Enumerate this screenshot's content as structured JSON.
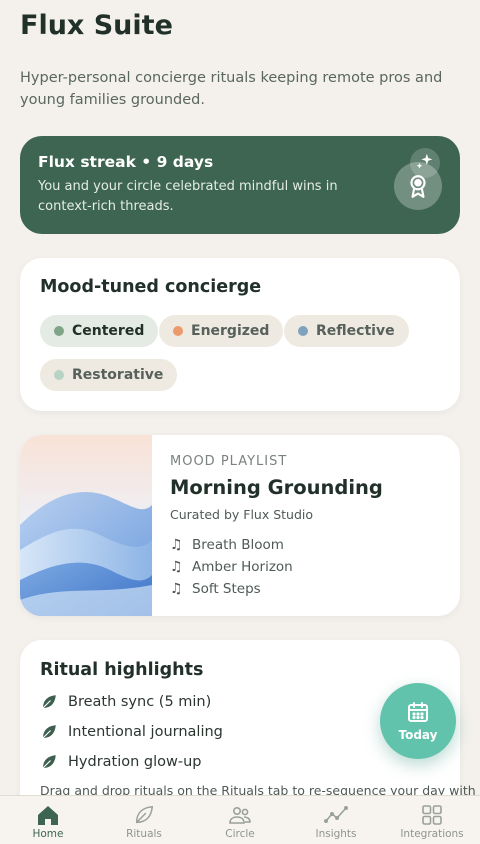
{
  "app": {
    "title": "Flux Suite",
    "subtitle": "Hyper-personal concierge rituals keeping remote pros and young families grounded."
  },
  "streak": {
    "title": "Flux streak • 9 days",
    "text": "You and your circle celebrated mindful wins in context-rich threads."
  },
  "mood": {
    "heading": "Mood-tuned concierge",
    "chips": [
      {
        "label": "Centered",
        "color": "#7fa487",
        "active": true
      },
      {
        "label": "Energized",
        "color": "#ec9a6b",
        "active": false
      },
      {
        "label": "Reflective",
        "color": "#7fa3bd",
        "active": false
      },
      {
        "label": "Restorative",
        "color": "#b7d3c3",
        "active": false
      }
    ]
  },
  "playlist": {
    "eyebrow": "MOOD PLAYLIST",
    "title": "Morning Grounding",
    "curator": "Curated by Flux Studio",
    "tracks": [
      "Breath Bloom",
      "Amber Horizon",
      "Soft Steps"
    ]
  },
  "rituals": {
    "heading": "Ritual highlights",
    "items": [
      "Breath sync (5 min)",
      "Intentional journaling",
      "Hydration glow-up"
    ],
    "note": "Drag and drop rituals on the Rituals tab to re-sequence your day with"
  },
  "fab": {
    "label": "Today"
  },
  "tabs": [
    {
      "label": "Home",
      "icon": "home-icon",
      "active": true
    },
    {
      "label": "Rituals",
      "icon": "leaf-icon",
      "active": false
    },
    {
      "label": "Circle",
      "icon": "people-icon",
      "active": false
    },
    {
      "label": "Insights",
      "icon": "chart-line-icon",
      "active": false
    },
    {
      "label": "Integrations",
      "icon": "grid-icon",
      "active": false
    }
  ],
  "colors": {
    "accent": "#3e6452",
    "fab": "#62c3ac",
    "background": "#f4f1ec"
  }
}
